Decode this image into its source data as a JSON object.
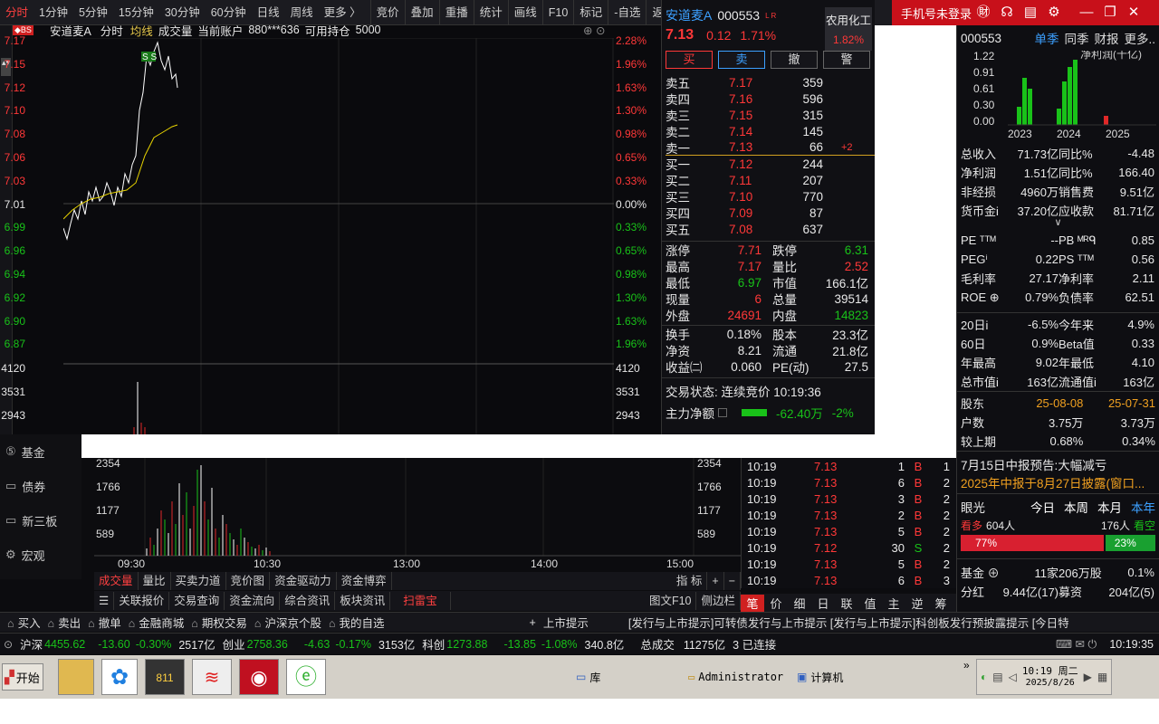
{
  "topbar": {
    "periods": [
      "分时",
      "1分钟",
      "5分钟",
      "15分钟",
      "30分钟",
      "60分钟",
      "日线",
      "周线",
      "更多 〉"
    ],
    "tools": [
      "竞价",
      "叠加",
      "重播",
      "统计",
      "画线",
      "F10",
      "标记",
      "-自选",
      "返回"
    ]
  },
  "rightTop": {
    "login": "手机号未登录"
  },
  "chartHeader": {
    "badge": "◆BS",
    "name": "安道麦A",
    "mode": "分时",
    "avg": "均线",
    "vol": "成交量",
    "acct": "当前账户",
    "acctNo": "880***636",
    "holdLabel": "可用持仓",
    "hold": "5000",
    "ss": "S S"
  },
  "priceAxis": {
    "left": [
      "7.17",
      "7.15",
      "7.12",
      "7.10",
      "7.08",
      "7.06",
      "7.03",
      "7.01",
      "6.99",
      "6.96",
      "6.94",
      "6.92",
      "6.90",
      "6.87"
    ],
    "right": [
      "2.28%",
      "1.96%",
      "1.63%",
      "1.30%",
      "0.98%",
      "0.65%",
      "0.33%",
      "0.00%",
      "0.33%",
      "0.65%",
      "0.98%",
      "1.30%",
      "1.63%",
      "1.96%"
    ]
  },
  "volAxis": [
    "4120",
    "3531",
    "2943",
    "2354",
    "1766",
    "1177",
    "589"
  ],
  "timeAxis": [
    "09:30",
    "10:30",
    "13:00",
    "14:00",
    "15:00"
  ],
  "quote": {
    "name": "安道麦A",
    "code": "000553",
    "tags": "L R",
    "price": "7.13",
    "chg": "0.12",
    "pct": "1.71%",
    "sector": "农用化工",
    "sectorPct": "1.82%",
    "actions": [
      "买",
      "卖",
      "撤",
      "警"
    ],
    "asks": [
      {
        "l": "卖五",
        "p": "7.17",
        "v": "359"
      },
      {
        "l": "卖四",
        "p": "7.16",
        "v": "596"
      },
      {
        "l": "卖三",
        "p": "7.15",
        "v": "315"
      },
      {
        "l": "卖二",
        "p": "7.14",
        "v": "145"
      },
      {
        "l": "卖一",
        "p": "7.13",
        "v": "66",
        "d": "+2"
      }
    ],
    "bids": [
      {
        "l": "买一",
        "p": "7.12",
        "v": "244"
      },
      {
        "l": "买二",
        "p": "7.11",
        "v": "207"
      },
      {
        "l": "买三",
        "p": "7.10",
        "v": "770"
      },
      {
        "l": "买四",
        "p": "7.09",
        "v": "87"
      },
      {
        "l": "买五",
        "p": "7.08",
        "v": "637"
      }
    ],
    "stats": [
      [
        "涨停",
        "7.71",
        "跌停",
        "6.31"
      ],
      [
        "最高",
        "7.17",
        "量比",
        "2.52"
      ],
      [
        "最低",
        "6.97",
        "市值",
        "166.1亿"
      ],
      [
        "现量",
        "6",
        "总量",
        "39514"
      ],
      [
        "外盘",
        "24691",
        "内盘",
        "14823"
      ]
    ],
    "stats2": [
      [
        "换手",
        "0.18%",
        "股本",
        "23.3亿"
      ],
      [
        "净资",
        "8.21",
        "流通",
        "21.8亿"
      ],
      [
        "收益㈡",
        "0.060",
        "PE(动)",
        "27.5"
      ]
    ],
    "status": "交易状态: 连续竞价 10:19:36",
    "flowLabel": "主力净额",
    "flowVal": "-62.40万",
    "flowPct": "-2%"
  },
  "fin": {
    "code": "000553",
    "tabs": [
      "单季",
      "同季",
      "财报",
      "更多.."
    ],
    "yticks": [
      "1.22",
      "0.91",
      "0.61",
      "0.30",
      "0.00"
    ],
    "years": [
      "2023",
      "2024",
      "2025"
    ],
    "legend": "净利润(十亿)",
    "rows": [
      [
        "总收入",
        "71.73亿",
        "同比%",
        "-4.48"
      ],
      [
        "净利润",
        "1.51亿",
        "同比%",
        "166.40"
      ],
      [
        "非经损",
        "4960万",
        "销售费",
        "9.51亿"
      ],
      [
        "货币金i",
        "37.20亿",
        "应收款",
        "81.71亿"
      ]
    ],
    "rows2": [
      [
        "PE ᵀᵀᴹ",
        "--",
        "PB ᴹᴿᑫ",
        "0.85"
      ],
      [
        "PEGⁱ",
        "0.22",
        "PS ᵀᵀᴹ",
        "0.56"
      ],
      [
        "毛利率",
        "27.17",
        "净利率",
        "2.11"
      ],
      [
        "ROE ⊕",
        "0.79%",
        "负债率",
        "62.51"
      ]
    ],
    "rows3": [
      [
        "20日i",
        "-6.5%",
        "今年来",
        "4.9%"
      ],
      [
        "60日",
        "0.9%",
        "Beta值",
        "0.33"
      ],
      [
        "年最高",
        "9.02",
        "年最低",
        "4.10"
      ],
      [
        "总市值i",
        "163亿",
        "流通值i",
        "163亿"
      ]
    ],
    "holders": [
      [
        "股东",
        "25-08-08",
        "25-07-31"
      ],
      [
        "户数",
        "3.75万",
        "3.73万"
      ],
      [
        "较上期",
        "0.68%",
        "0.34%"
      ]
    ],
    "news": [
      "7月15日中报预告:大幅减亏",
      "2025年中报于8月27日披露(窗口..."
    ],
    "eye": {
      "title": "眼光",
      "tabs": [
        "今日",
        "本周",
        "本月",
        "本年"
      ],
      "bull": "看多",
      "bullN": "604人",
      "bearN": "176人",
      "bear": "看空",
      "bullPct": "77%",
      "bearPct": "23%"
    },
    "fund": [
      [
        "基金 ⊕",
        "11家",
        "206万股",
        "0.1%"
      ],
      [
        "分红",
        "9.44亿(17)",
        "募资",
        "204亿(5)"
      ]
    ]
  },
  "sidebar": [
    "基金",
    "债券",
    "新三板",
    "宏观"
  ],
  "ticks": [
    [
      "10:19",
      "7.13",
      "1",
      "B",
      "1"
    ],
    [
      "10:19",
      "7.13",
      "6",
      "B",
      "2"
    ],
    [
      "10:19",
      "7.13",
      "3",
      "B",
      "2"
    ],
    [
      "10:19",
      "7.13",
      "2",
      "B",
      "2"
    ],
    [
      "10:19",
      "7.13",
      "5",
      "B",
      "2"
    ],
    [
      "10:19",
      "7.12",
      "30",
      "S",
      "2"
    ],
    [
      "10:19",
      "7.13",
      "5",
      "B",
      "2"
    ],
    [
      "10:19",
      "7.13",
      "6",
      "B",
      "3"
    ]
  ],
  "tabs1": [
    "成交量",
    "量比",
    "买卖力道",
    "竞价图",
    "资金驱动力",
    "资金博弈"
  ],
  "tabs1r": [
    "指 标",
    "+",
    "−"
  ],
  "tabs2": [
    "☰",
    "关联报价",
    "交易查询",
    "资金流向",
    "综合资讯",
    "板块资讯",
    "扫雷宝"
  ],
  "tabs2r": [
    "图文F10",
    "侧边栏"
  ],
  "ticktabs": [
    "笔",
    "价",
    "细",
    "日",
    "联",
    "值",
    "主",
    "逆",
    "筹"
  ],
  "tradebar": [
    "买入",
    "卖出",
    "撤单",
    "金融商城",
    "期权交易",
    "沪深京个股",
    "我的自选",
    "+",
    "上市提示"
  ],
  "ticker": "[发行与上市提示]可转债发行与上市提示        [发行与上市提示]科创板发行预披露提示        [今日特",
  "idx": [
    {
      "n": "沪深",
      "v": "4455.62",
      "c": "-13.60",
      "p": "-0.30%",
      "a": "2517亿"
    },
    {
      "n": "创业",
      "v": "2758.36",
      "c": "-4.63",
      "p": "-0.17%",
      "a": "3153亿"
    },
    {
      "n": "科创",
      "v": "1273.88",
      "c": "-13.85",
      "p": "-1.08%",
      "a": "340.8亿"
    }
  ],
  "total": {
    "l": "总成交",
    "v": "11275亿",
    "conn": "3 已连接",
    "time": "10:19:35"
  },
  "taskbar": {
    "start": "开始",
    "items": [
      "库",
      "Administrator",
      "计算机"
    ],
    "time": "10:19 周二",
    "date": "2025/8/26"
  }
}
